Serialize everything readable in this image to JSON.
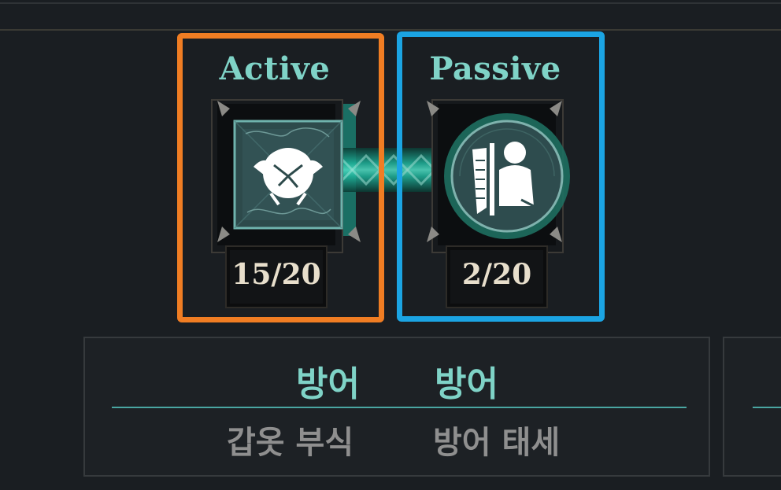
{
  "skills": {
    "active": {
      "title": "Active",
      "rank": "15/20",
      "icon": "armor-shatter-icon",
      "highlight_color": "#f07d23"
    },
    "passive": {
      "title": "Passive",
      "rank": "2/20",
      "icon": "shield-stance-icon",
      "highlight_color": "#1ba4e3"
    }
  },
  "info_panel": {
    "categories": [
      "방어",
      "방어"
    ],
    "skill_names": [
      "갑옷 부식",
      "방어 태세"
    ]
  },
  "colors": {
    "accent": "#7fd3c7",
    "link_glow": "#1fb39b",
    "background": "#1a1e22"
  }
}
